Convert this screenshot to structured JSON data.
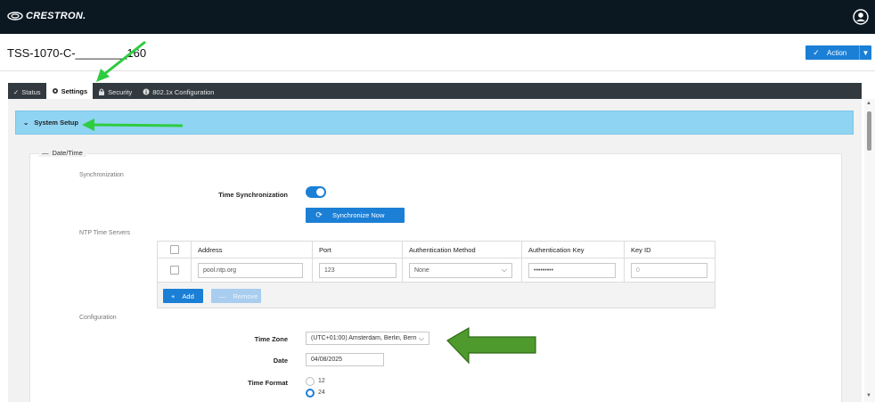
{
  "header": {
    "brand": "CRESTRON.",
    "user_icon": "user-circle-icon"
  },
  "device": {
    "name": "TSS-1070-C-________160",
    "action_label": "Action"
  },
  "tabs": [
    {
      "label": "Status",
      "icon": "check-icon"
    },
    {
      "label": "Settings",
      "icon": "gear-icon",
      "active": true
    },
    {
      "label": "Security",
      "icon": "lock-icon"
    },
    {
      "label": "802.1x Configuration",
      "icon": "info-circle-icon"
    }
  ],
  "system_setup": {
    "title": "System Setup"
  },
  "datetime": {
    "legend": "Date/Time",
    "sync_section": "Synchronization",
    "time_sync_label": "Time Synchronization",
    "time_sync_enabled": true,
    "sync_now_label": "Synchronize Now",
    "ntp_section": "NTP Time Servers",
    "ntp_columns": [
      "Address",
      "Port",
      "Authentication Method",
      "Authentication Key",
      "Key ID"
    ],
    "ntp_rows": [
      {
        "address": "pool.ntp.org",
        "port": "123",
        "auth_method": "None",
        "auth_key": "•••••••••",
        "key_id": "0"
      }
    ],
    "add_label": "Add",
    "remove_label": "Remove",
    "config_section": "Configuration",
    "time_zone_label": "Time Zone",
    "time_zone_value": "(UTC+01:00) Amsterdam, Berlin, Bern",
    "date_label": "Date",
    "date_value": "04/08/2025",
    "time_format_label": "Time Format",
    "time_format_options": [
      "12",
      "24"
    ],
    "time_format_selected": "24"
  },
  "colors": {
    "topbar": "#0b1822",
    "accent": "#1b7fd6",
    "section_header": "#8fd4f2",
    "annotation_green": "#2ecc40",
    "annotation_block_arrow": "#4f9a2c"
  }
}
